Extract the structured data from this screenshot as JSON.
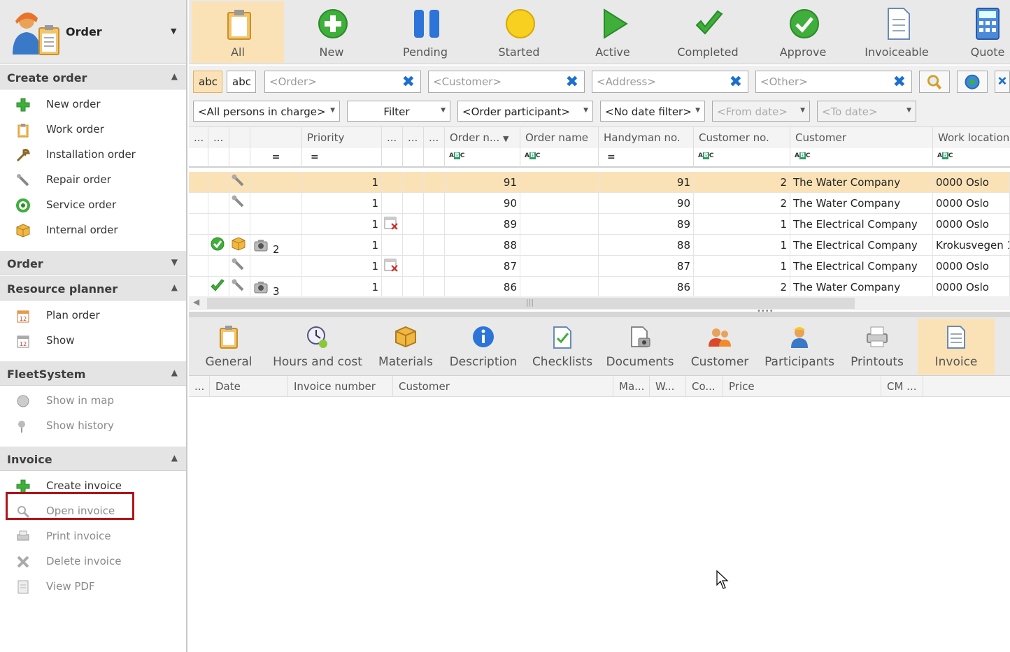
{
  "sidebar": {
    "title": "Order",
    "sections": [
      {
        "label": "Create order",
        "items": [
          "New order",
          "Work order",
          "Installation order",
          "Repair order",
          "Service order",
          "Internal order"
        ]
      },
      {
        "label": "Order",
        "items": []
      },
      {
        "label": "Resource planner",
        "items": [
          "Plan order",
          "Show"
        ]
      },
      {
        "label": "FleetSystem",
        "items": [
          "Show in map",
          "Show history"
        ]
      },
      {
        "label": "Invoice",
        "items": [
          "Create invoice",
          "Open invoice",
          "Print invoice",
          "Delete invoice",
          "View PDF"
        ]
      }
    ]
  },
  "toolbar": [
    "All",
    "New",
    "Pending",
    "Started",
    "Active",
    "Completed",
    "Approve",
    "Invoiceable",
    "Quote"
  ],
  "filters": {
    "abc1": "abc",
    "abc2": "abc",
    "order": "<Order>",
    "customer": "<Customer>",
    "address": "<Address>",
    "other": "<Other>",
    "persons": "<All persons in charge>",
    "filter": "Filter",
    "participant": "<Order participant>",
    "date": "<No date filter>",
    "from": "<From date>",
    "to": "<To date>"
  },
  "grid": {
    "headers": [
      "...",
      "...",
      "",
      "Priority",
      "...",
      "...",
      "...",
      "Order n...",
      "Order name",
      "Handyman no.",
      "Customer no.",
      "Customer",
      "Work location"
    ],
    "filter_eq": "=",
    "filter_abc": "ABC",
    "rows": [
      {
        "extra": "",
        "priority": "1",
        "order_no": "91",
        "order_name": "",
        "handyman": "91",
        "cust_no": "2",
        "customer": "The Water Company",
        "location": "0000 Oslo"
      },
      {
        "extra": "",
        "priority": "1",
        "order_no": "90",
        "order_name": "",
        "handyman": "90",
        "cust_no": "2",
        "customer": "The Water Company",
        "location": "0000 Oslo"
      },
      {
        "extra": "",
        "priority": "1",
        "order_no": "89",
        "order_name": "",
        "handyman": "89",
        "cust_no": "1",
        "customer": "The Electrical Company",
        "location": "0000 Oslo"
      },
      {
        "extra": "2",
        "priority": "1",
        "order_no": "88",
        "order_name": "",
        "handyman": "88",
        "cust_no": "1",
        "customer": "The Electrical Company",
        "location": "Krokusvegen 1"
      },
      {
        "extra": "",
        "priority": "1",
        "order_no": "87",
        "order_name": "",
        "handyman": "87",
        "cust_no": "1",
        "customer": "The Electrical Company",
        "location": "0000 Oslo"
      },
      {
        "extra": "3",
        "priority": "1",
        "order_no": "86",
        "order_name": "",
        "handyman": "86",
        "cust_no": "2",
        "customer": "The Water Company",
        "location": "0000 Oslo"
      }
    ]
  },
  "detail_tabs": [
    "General",
    "Hours and cost",
    "Materials",
    "Description",
    "Checklists",
    "Documents",
    "Customer",
    "Participants",
    "Printouts",
    "Invoice"
  ],
  "invoice_headers": [
    "...",
    "Date",
    "Invoice number",
    "Customer",
    "Ma...",
    "W...",
    "Co...",
    "Price",
    "CM ..."
  ],
  "colors": {
    "selected": "#fbe2b6",
    "highlight": "#b1141a",
    "accent": "#1b6fd0"
  }
}
